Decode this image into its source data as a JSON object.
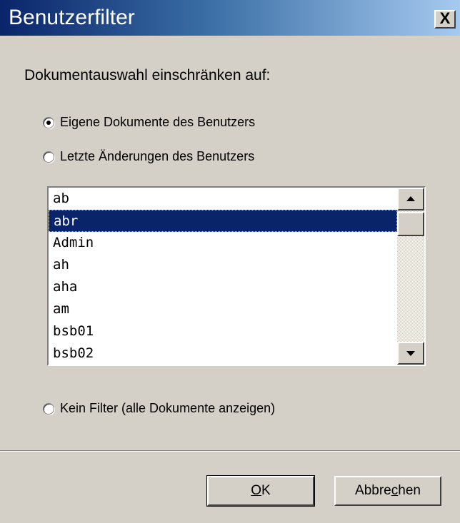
{
  "window": {
    "title": "Benutzerfilter",
    "close_label": "X"
  },
  "main": {
    "prompt": "Dokumentauswahl einschränken auf:"
  },
  "options": [
    {
      "label": "Eigene Dokumente des Benutzers",
      "checked": true
    },
    {
      "label": "Letzte Änderungen des Benutzers",
      "checked": false
    },
    {
      "label": "Kein Filter (alle Dokumente anzeigen)",
      "checked": false
    }
  ],
  "user_list": {
    "items": [
      "ab",
      "abr",
      "Admin",
      "ah",
      "aha",
      "am",
      "bsb01",
      "bsb02"
    ],
    "selected": "abr",
    "scroll_up_icon": "triangle-up-icon",
    "scroll_down_icon": "triangle-down-icon"
  },
  "buttons": {
    "ok_label": "OK",
    "ok_mnemonic": "O",
    "ok_rest": "K",
    "cancel_label": "Abbrechen",
    "cancel_pre": "Abbre",
    "cancel_mnemonic": "c",
    "cancel_post": "hen"
  }
}
